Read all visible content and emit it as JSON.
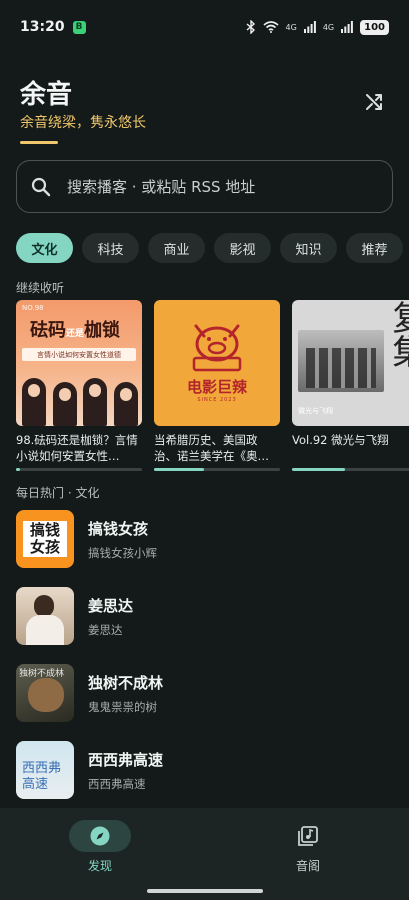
{
  "status_bar": {
    "time": "13:20",
    "notification_badge": "B",
    "network_1": "4G",
    "network_2": "4G",
    "battery": "100"
  },
  "header": {
    "title": "余音",
    "subtitle": "余音绕梁，隽永悠长"
  },
  "search": {
    "placeholder": "搜索播客 · 或粘贴 RSS 地址"
  },
  "tabs": [
    {
      "label": "文化",
      "active": true
    },
    {
      "label": "科技",
      "active": false
    },
    {
      "label": "商业",
      "active": false
    },
    {
      "label": "影视",
      "active": false
    },
    {
      "label": "知识",
      "active": false
    },
    {
      "label": "推荐",
      "active": false
    }
  ],
  "continue_section": {
    "label": "继续收听",
    "cards": [
      {
        "title": "98.砝码还是枷锁？言情小说如何安置女性…",
        "progress": 0.03,
        "cover_text": {
          "no": "NO.98",
          "big_1": "砝码",
          "small": "还是",
          "big_2": "枷锁",
          "band": "言情小说如何安置女性道德"
        }
      },
      {
        "title": "当希腊历史、美国政治、诺兰美学在《奥…",
        "progress": 0.4,
        "cover_text": {
          "main": "电影巨辣",
          "since": "SINCE 2023"
        }
      },
      {
        "title": "Vol.92 微光与飞翔",
        "progress": 0.42,
        "cover_text": {
          "big": "复集",
          "caption": "微光与飞翔"
        }
      }
    ]
  },
  "daily_section": {
    "label": "每日热门 · 文化",
    "items": [
      {
        "title": "搞钱女孩",
        "author": "搞钱女孩小辉",
        "cover_text": "搞钱女孩"
      },
      {
        "title": "姜思达",
        "author": "姜思达"
      },
      {
        "title": "独树不成林",
        "author": "鬼鬼祟祟的树",
        "cover_text": "独树不成林"
      },
      {
        "title": "西西弗高速",
        "author": "西西弗高速",
        "cover_text": "西西弗高速"
      }
    ]
  },
  "bottom_nav": [
    {
      "label": "发现",
      "active": true
    },
    {
      "label": "音阁",
      "active": false
    }
  ],
  "colors": {
    "accent": "#84d6c3",
    "subtitle": "#f0c76a",
    "background": "#141a1a"
  }
}
